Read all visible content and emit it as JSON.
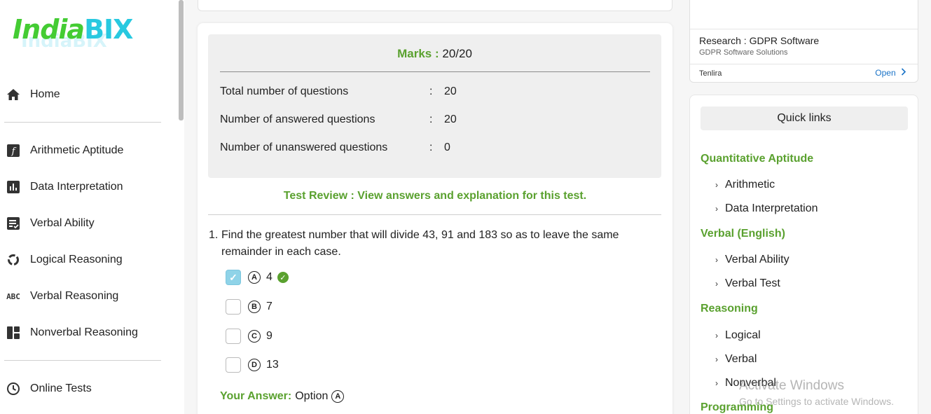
{
  "logo": {
    "text_a": "India",
    "text_b": "BIX"
  },
  "sidebar": {
    "items": [
      {
        "label": "Home",
        "icon": "home-icon"
      },
      {
        "label": "Arithmetic Aptitude",
        "icon": "function-icon"
      },
      {
        "label": "Data Interpretation",
        "icon": "bar-chart-icon"
      },
      {
        "label": "Verbal Ability",
        "icon": "checklist-icon"
      },
      {
        "label": "Logical Reasoning",
        "icon": "cycle-icon"
      },
      {
        "label": "Verbal Reasoning",
        "icon": "abc-icon"
      },
      {
        "label": "Nonverbal Reasoning",
        "icon": "dashboard-icon"
      },
      {
        "label": "Online Tests",
        "icon": "clock-icon"
      }
    ],
    "abc_glyph": "ABC"
  },
  "result": {
    "marks_label": "Marks :",
    "marks_value": "20/20",
    "stats": [
      {
        "label": "Total number of questions",
        "colon": ":",
        "value": "20"
      },
      {
        "label": "Number of answered questions",
        "colon": ":",
        "value": "20"
      },
      {
        "label": "Number of unanswered questions",
        "colon": ":",
        "value": "0"
      }
    ],
    "review_link": "Test Review : View answers and explanation for this test."
  },
  "question": {
    "number": "1.",
    "text": "Find the greatest number that will divide 43, 91 and 183 so as to leave the same remainder in each case.",
    "options": [
      {
        "letter": "A",
        "value": "4",
        "checked": true,
        "correct": true
      },
      {
        "letter": "B",
        "value": "7",
        "checked": false
      },
      {
        "letter": "C",
        "value": "9",
        "checked": false
      },
      {
        "letter": "D",
        "value": "13",
        "checked": false
      }
    ],
    "your_answer_label": "Your Answer:",
    "your_answer_text": "Option",
    "your_answer_letter": "A"
  },
  "ad": {
    "title": "Research : GDPR Software",
    "subtitle": "GDPR Software Solutions",
    "brand": "Tenlira",
    "open_label": "Open"
  },
  "quick_links": {
    "title": "Quick links",
    "sections": [
      {
        "label": "Quantitative Aptitude",
        "links": [
          "Arithmetic",
          "Data Interpretation"
        ]
      },
      {
        "label": "Verbal (English)",
        "links": [
          "Verbal Ability",
          "Verbal Test"
        ]
      },
      {
        "label": "Reasoning",
        "links": [
          "Logical",
          "Verbal",
          "Nonverbal"
        ]
      },
      {
        "label": "Programming",
        "links": []
      }
    ]
  },
  "watermark": {
    "line1": "Activate Windows",
    "line2": "Go to Settings to activate Windows."
  },
  "colors": {
    "accent_green": "#5aa12f",
    "logo_green": "#44cc33",
    "logo_cyan": "#28c9e0",
    "checkbox_blue": "#8fd3e8"
  }
}
